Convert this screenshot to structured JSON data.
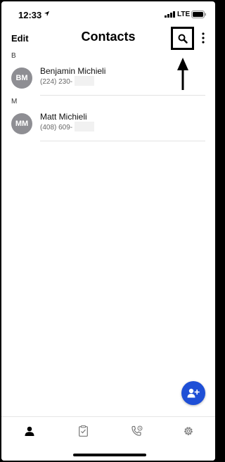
{
  "status_bar": {
    "time": "12:33",
    "network": "LTE"
  },
  "header": {
    "edit_label": "Edit",
    "title": "Contacts"
  },
  "sections": [
    {
      "letter": "B",
      "contacts": [
        {
          "initials": "BM",
          "name": "Benjamin Michieli",
          "phone": "(224) 230-"
        }
      ]
    },
    {
      "letter": "M",
      "contacts": [
        {
          "initials": "MM",
          "name": "Matt Michieli",
          "phone": "(408) 609-"
        }
      ]
    }
  ],
  "tabs": [
    "contacts-person-icon",
    "clipboard-icon",
    "call-history-icon",
    "settings-gear-icon"
  ],
  "colors": {
    "accent": "#1e4fd6",
    "avatar": "#8e8e93"
  }
}
